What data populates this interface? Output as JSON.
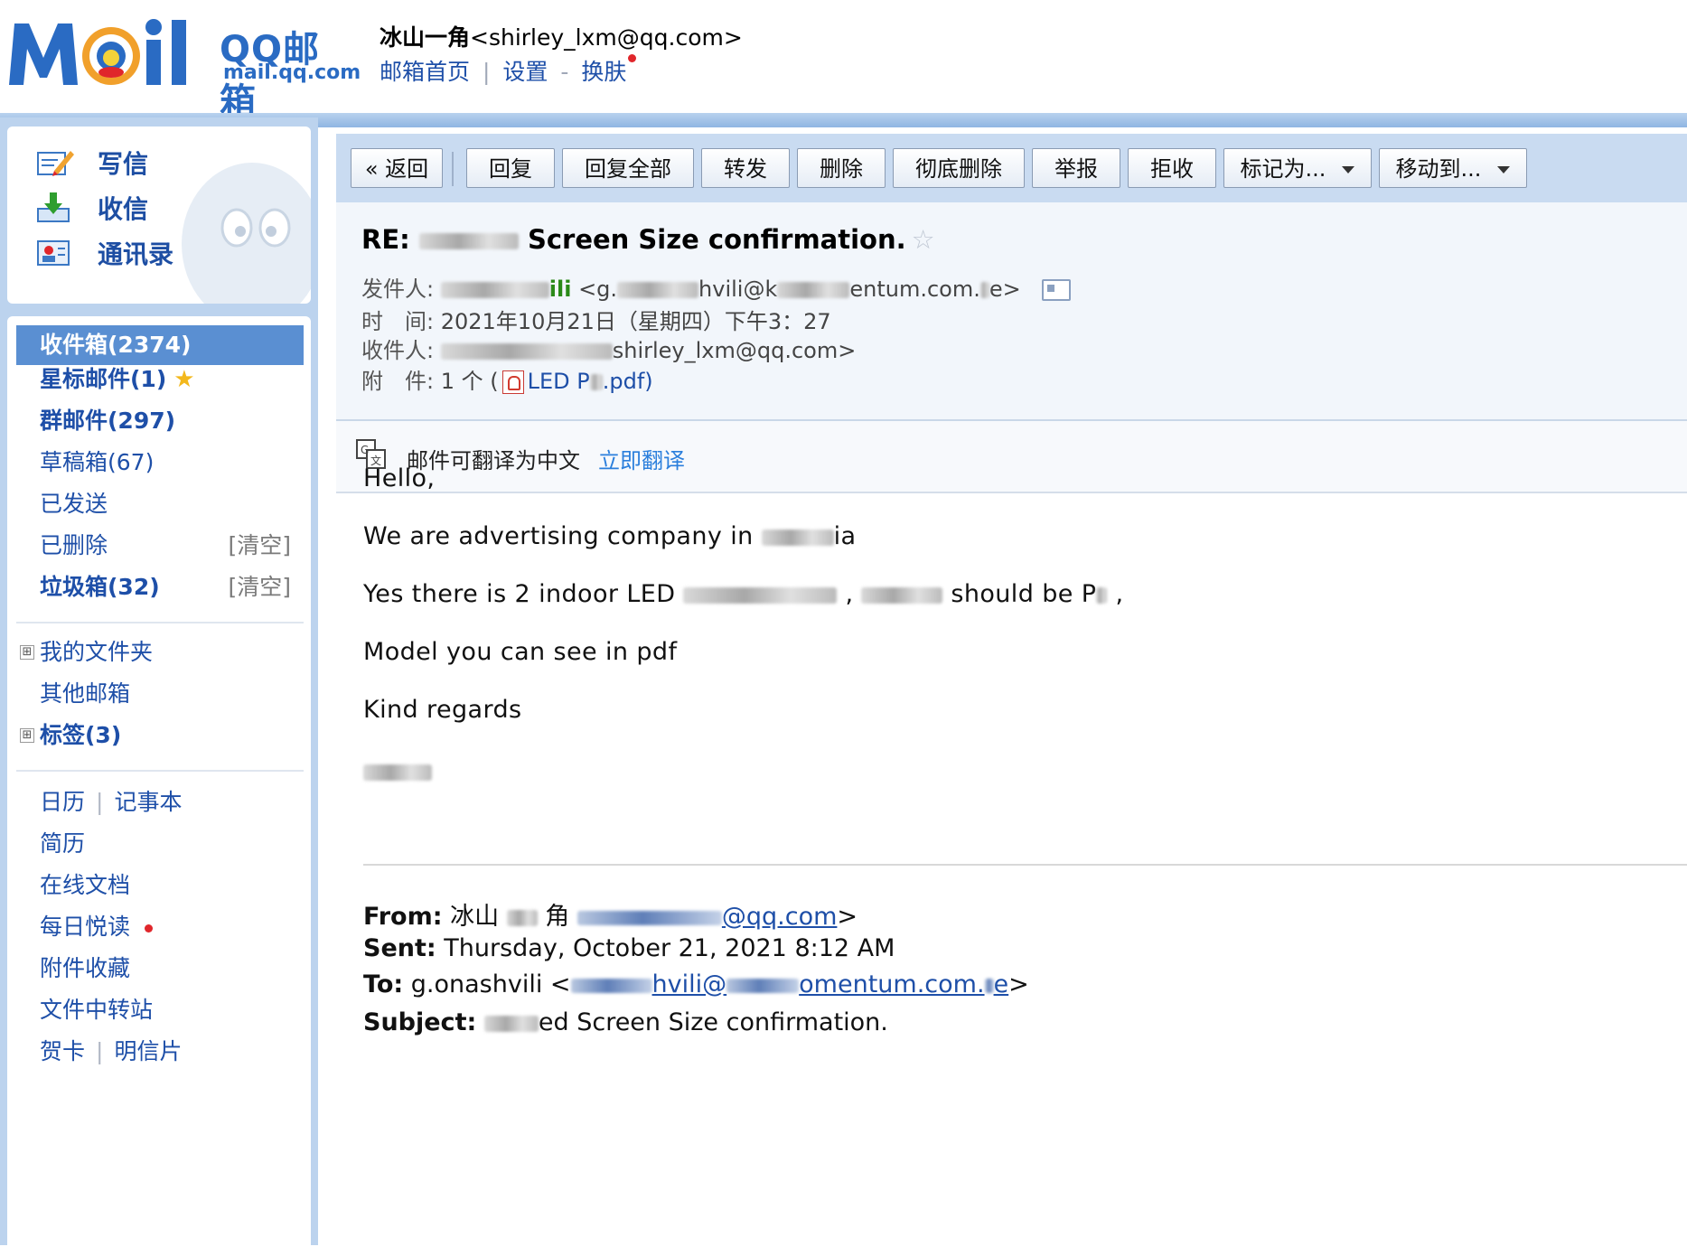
{
  "header": {
    "logo_qq": "QQ邮箱",
    "logo_domain": "mail.qq.com",
    "user_name": "冰山一角",
    "user_email": "<shirley_lxm@qq.com>",
    "links": {
      "home": "邮箱首页",
      "sep": "|",
      "settings": "设置",
      "dash": "-",
      "skin": "换肤"
    }
  },
  "sidebar": {
    "quick": {
      "compose": "写信",
      "inbox": "收信",
      "contacts": "通讯录"
    },
    "folders": {
      "inbox": "收件箱(2374)",
      "starred": "星标邮件(1)",
      "group": "群邮件(297)",
      "drafts": "草稿箱(67)",
      "sent": "已发送",
      "deleted": "已删除",
      "spam": "垃圾箱(32)",
      "clear": "[清空]",
      "my_folders": "我的文件夹",
      "other_mailbox": "其他邮箱",
      "tags": "标签(3)",
      "expand": "⊞"
    },
    "apps": {
      "calendar": "日历",
      "sep": "|",
      "notebook": "记事本",
      "resume": "简历",
      "online_docs": "在线文档",
      "daily_read": "每日悦读",
      "attachments": "附件收藏",
      "file_transfer": "文件中转站",
      "greeting_card": "贺卡",
      "postcard": "明信片"
    }
  },
  "toolbar": {
    "back": "« 返回",
    "reply": "回复",
    "reply_all": "回复全部",
    "forward": "转发",
    "delete": "删除",
    "delete_permanent": "彻底删除",
    "report": "举报",
    "reject": "拒收",
    "mark_as": "标记为...",
    "move_to": "移动到..."
  },
  "mail": {
    "subject_prefix": "RE:",
    "subject_rest": "Screen Size confirmation.",
    "from_label": "发件人:",
    "from_name_tail": "ili",
    "from_email_a": "<g.",
    "from_email_b": "hvili@k",
    "from_email_c": "entum.com.",
    "from_email_d": "e>",
    "time_label": "时　间:",
    "time_value": "2021年10月21日（星期四）下午3：27",
    "to_label": "收件人:",
    "to_value": "shirley_lxm@qq.com>",
    "attach_label": "附　件:",
    "attach_count": "1 个 (",
    "attach_name_a": "LED P",
    "attach_name_b": ".pdf)"
  },
  "translate": {
    "text": "邮件可翻译为中文",
    "link": "立即翻译"
  },
  "body": {
    "greeting": "Hello,",
    "line1_a": "We are advertising company in",
    "line1_b": "ia",
    "line2_a": "Yes there is 2 indoor LED",
    "line2_b": ",",
    "line2_c": "should be P",
    "line2_d": ",",
    "line3": "Model you can see in pdf",
    "line4": "Kind regards"
  },
  "quoted": {
    "from_label": "From:",
    "from_name": "冰山",
    "from_name2": "角",
    "from_email_tail": "@qq.com",
    "from_close": ">",
    "sent_label": "Sent:",
    "sent_value": "Thursday, October 21, 2021 8:12 AM",
    "to_label": "To:",
    "to_value": "g.onashvili <",
    "to_email_a": "hvili@",
    "to_email_b": "omentum.com.",
    "to_email_c": "e",
    "to_close": ">",
    "subject_label": "Subject:",
    "subject_tail": "ed Screen Size confirmation."
  },
  "colors": {
    "brand_blue": "#2a6bc3",
    "link_blue": "#1e4fa8",
    "active_folder": "#5a8fd2",
    "toolbar_bg": "#c9dbf1",
    "sidebar_bg": "#bcd3ee"
  }
}
